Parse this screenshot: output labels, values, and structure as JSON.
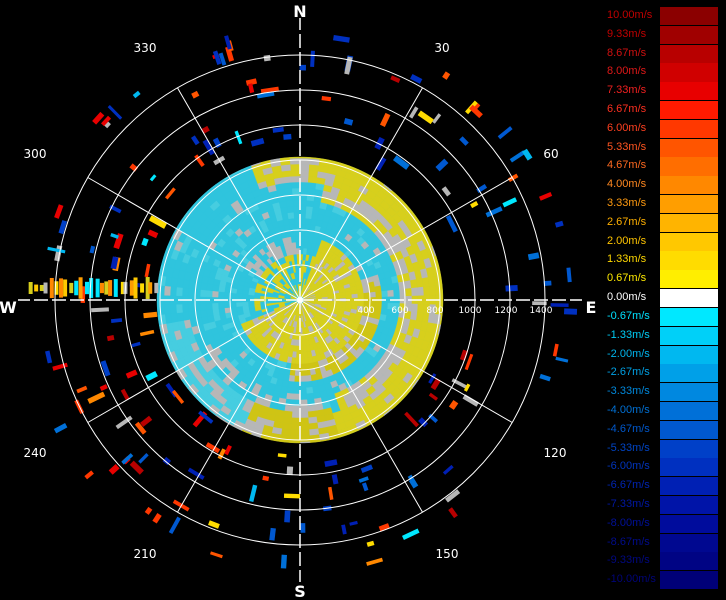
{
  "compass": {
    "north": "N",
    "south": "S",
    "east": "E",
    "west": "W"
  },
  "azimuth_labels": [
    "30",
    "60",
    "120",
    "150",
    "210",
    "240",
    "300",
    "330"
  ],
  "range_labels": [
    "400",
    "600",
    "800",
    "1000",
    "1200",
    "1400"
  ],
  "legend": [
    {
      "label": "10.00m/s",
      "color": "#8b0000",
      "text_color": "#c00000"
    },
    {
      "label": "9.33m/s",
      "color": "#a00000",
      "text_color": "#c00000"
    },
    {
      "label": "8.67m/s",
      "color": "#b80000",
      "text_color": "#d01010"
    },
    {
      "label": "8.00m/s",
      "color": "#d00000",
      "text_color": "#e01818"
    },
    {
      "label": "7.33m/s",
      "color": "#e80000",
      "text_color": "#f02020"
    },
    {
      "label": "6.67m/s",
      "color": "#ff1a00",
      "text_color": "#ff3020"
    },
    {
      "label": "6.00m/s",
      "color": "#ff3800",
      "text_color": "#ff4020"
    },
    {
      "label": "5.33m/s",
      "color": "#ff5500",
      "text_color": "#ff5520"
    },
    {
      "label": "4.67m/s",
      "color": "#ff6e00",
      "text_color": "#ff6a20"
    },
    {
      "label": "4.00m/s",
      "color": "#ff8800",
      "text_color": "#ff8820"
    },
    {
      "label": "3.33m/s",
      "color": "#ff9e00",
      "text_color": "#ff9a10"
    },
    {
      "label": "2.67m/s",
      "color": "#ffb400",
      "text_color": "#ffb000"
    },
    {
      "label": "2.00m/s",
      "color": "#ffc800",
      "text_color": "#ffc400"
    },
    {
      "label": "1.33m/s",
      "color": "#ffdc00",
      "text_color": "#ffd800"
    },
    {
      "label": "0.67m/s",
      "color": "#ffee00",
      "text_color": "#ffea00"
    },
    {
      "label": "0.00m/s",
      "color": "#ffffff",
      "text_color": "#ffffff"
    },
    {
      "label": "-0.67m/s",
      "color": "#00e8ff",
      "text_color": "#00e0ff"
    },
    {
      "label": "-1.33m/s",
      "color": "#00d0f8",
      "text_color": "#00ccf4"
    },
    {
      "label": "-2.00m/s",
      "color": "#00b8f0",
      "text_color": "#00b4ec"
    },
    {
      "label": "-2.67m/s",
      "color": "#00a0e8",
      "text_color": "#00a0e4"
    },
    {
      "label": "-3.33m/s",
      "color": "#0088e0",
      "text_color": "#0088dc"
    },
    {
      "label": "-4.00m/s",
      "color": "#0070d8",
      "text_color": "#0070d4"
    },
    {
      "label": "-4.67m/s",
      "color": "#0058d0",
      "text_color": "#0058cc"
    },
    {
      "label": "-5.33m/s",
      "color": "#0040c8",
      "text_color": "#0044c4"
    },
    {
      "label": "-6.00m/s",
      "color": "#0030c0",
      "text_color": "#0034bc"
    },
    {
      "label": "-6.67m/s",
      "color": "#0020b4",
      "text_color": "#0024b0"
    },
    {
      "label": "-7.33m/s",
      "color": "#0014a8",
      "text_color": "#0018a4"
    },
    {
      "label": "-8.00m/s",
      "color": "#000c9c",
      "text_color": "#001098"
    },
    {
      "label": "-8.67m/s",
      "color": "#000890",
      "text_color": "#000c8c"
    },
    {
      "label": "-9.33m/s",
      "color": "#000484",
      "text_color": "#000880"
    },
    {
      "label": "-10.00m/s",
      "color": "#000078",
      "text_color": "#000478"
    }
  ]
}
